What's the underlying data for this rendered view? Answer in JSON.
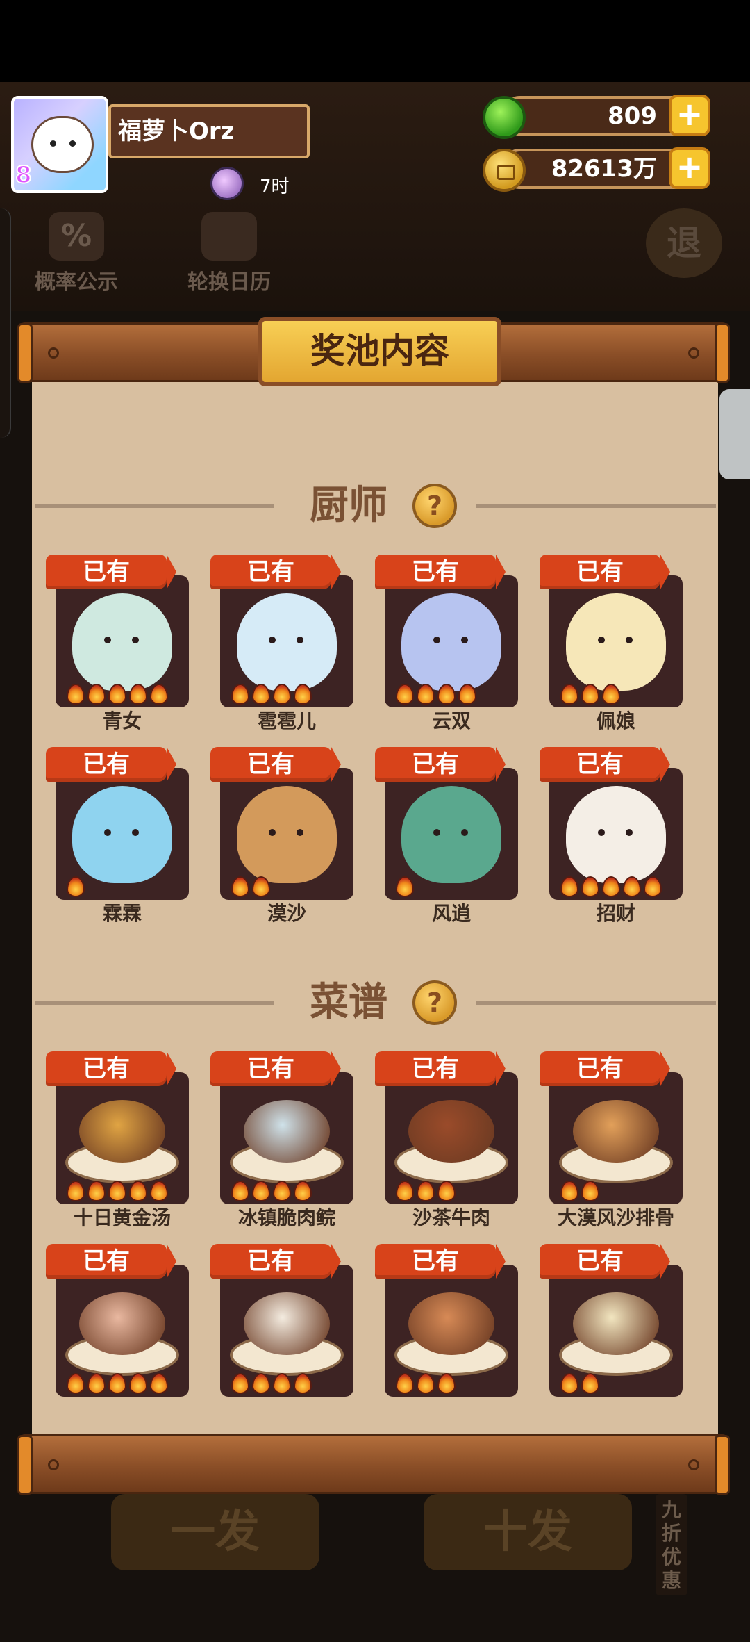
{
  "player": {
    "name": "福萝卜Orz",
    "avatar_badge": "8",
    "timer": "7时"
  },
  "resources": {
    "gems": "809",
    "coins": "82613万"
  },
  "hud_buttons": {
    "probability": "概率公示",
    "probability_icon": "%",
    "rotation_calendar": "轮换日历",
    "exit": "退"
  },
  "panel": {
    "title": "奖池内容",
    "sections": [
      {
        "title": "厨师",
        "items": [
          {
            "name": "青女",
            "status": "已有",
            "stars": 5,
            "color": "#cfe9e0"
          },
          {
            "name": "雹雹儿",
            "status": "已有",
            "stars": 4,
            "color": "#d6ebf7"
          },
          {
            "name": "云双",
            "status": "已有",
            "stars": 4,
            "color": "#b7c4f0"
          },
          {
            "name": "佩娘",
            "status": "已有",
            "stars": 3,
            "color": "#f6e7b8"
          },
          {
            "name": "霖霖",
            "status": "已有",
            "stars": 1,
            "color": "#8fd3ef"
          },
          {
            "name": "漠沙",
            "status": "已有",
            "stars": 2,
            "color": "#d39a5b"
          },
          {
            "name": "风逍",
            "status": "已有",
            "stars": 1,
            "color": "#5aa88e"
          },
          {
            "name": "招财",
            "status": "已有",
            "stars": 5,
            "color": "#f4eee6"
          }
        ]
      },
      {
        "title": "菜谱",
        "items": [
          {
            "name": "十日黄金汤",
            "status": "已有",
            "stars": 5,
            "color": "#e0a443"
          },
          {
            "name": "冰镇脆肉鲩",
            "status": "已有",
            "stars": 4,
            "color": "#cfe2ea"
          },
          {
            "name": "沙茶牛肉",
            "status": "已有",
            "stars": 3,
            "color": "#9a4b2a"
          },
          {
            "name": "大漠风沙排骨",
            "status": "已有",
            "stars": 2,
            "color": "#e2a05a"
          },
          {
            "name": "",
            "status": "已有",
            "stars": 5,
            "color": "#e9b8a0"
          },
          {
            "name": "",
            "status": "已有",
            "stars": 4,
            "color": "#f4ece0"
          },
          {
            "name": "",
            "status": "已有",
            "stars": 3,
            "color": "#d78a56"
          },
          {
            "name": "",
            "status": "已有",
            "stars": 2,
            "color": "#f2e6c0"
          }
        ]
      }
    ]
  },
  "bottom_buttons": {
    "single": "一发",
    "ten": "十发",
    "discount": "九折优惠"
  }
}
